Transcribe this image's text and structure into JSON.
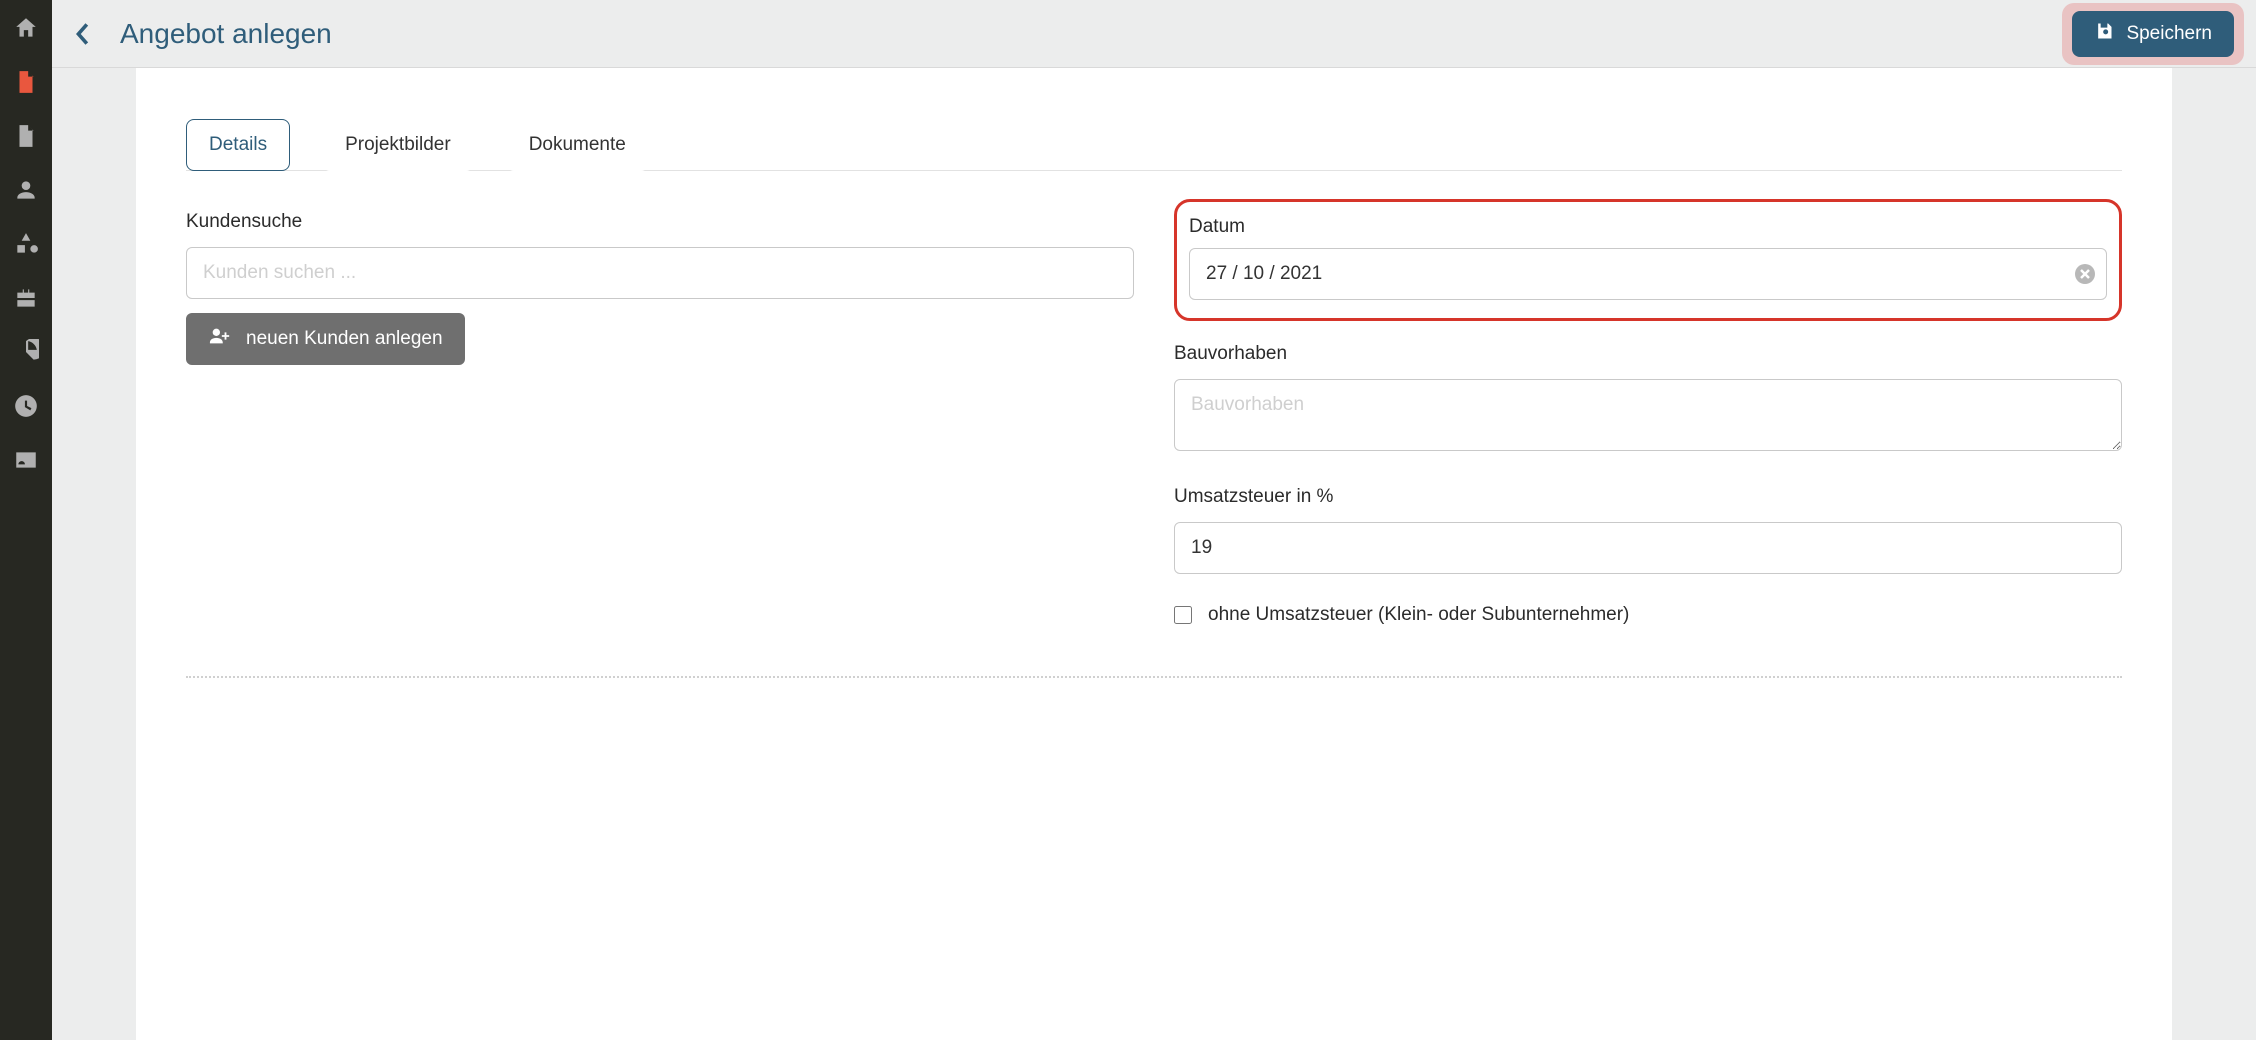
{
  "header": {
    "title": "Angebot anlegen",
    "save_label": "Speichern"
  },
  "tabs": {
    "details": "Details",
    "projektbilder": "Projektbilder",
    "dokumente": "Dokumente"
  },
  "form": {
    "kundensuche_label": "Kundensuche",
    "kundensuche_placeholder": "Kunden suchen ...",
    "neuer_kunde_label": "neuen Kunden anlegen",
    "datum_label": "Datum",
    "datum_value": "27 / 10 / 2021",
    "bauvorhaben_label": "Bauvorhaben",
    "bauvorhaben_placeholder": "Bauvorhaben",
    "umsatzsteuer_label": "Umsatzsteuer in %",
    "umsatzsteuer_value": "19",
    "ohne_umsatzsteuer_label": "ohne Umsatzsteuer (Klein- oder Subunternehmer)"
  },
  "sidebar_icons": [
    "home",
    "document",
    "invoice",
    "user",
    "shapes",
    "toolbox",
    "chart-pie",
    "clock",
    "contact-card"
  ]
}
